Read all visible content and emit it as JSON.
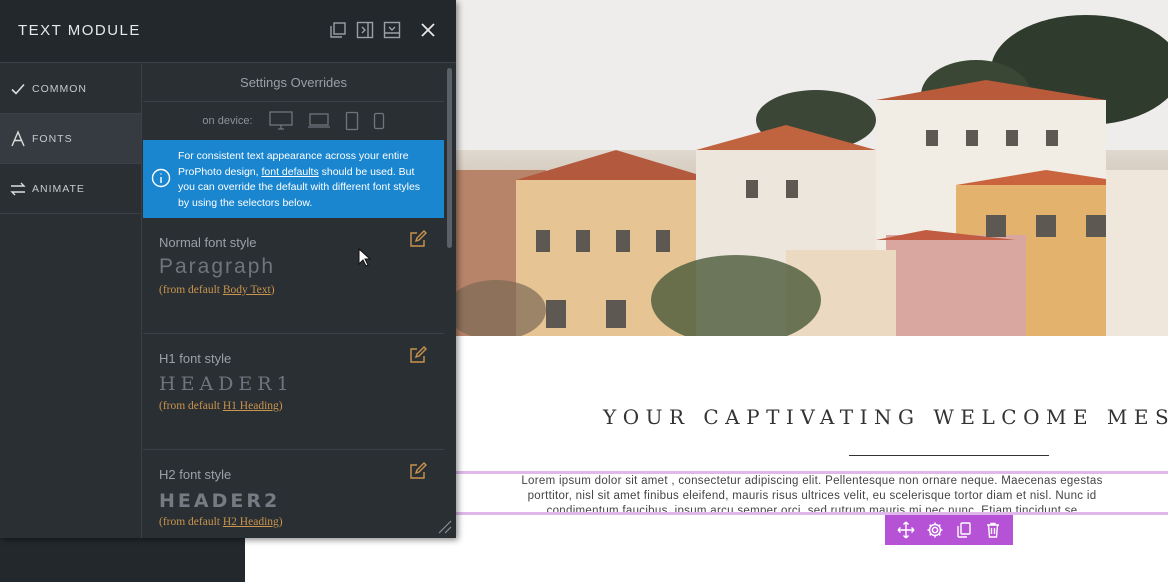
{
  "panel": {
    "title": "TEXT MODULE",
    "header_icons": [
      "duplicate-icon",
      "dock-right-icon",
      "minimize-icon",
      "close-icon"
    ]
  },
  "nav": {
    "items": [
      {
        "label": "COMMON",
        "icon": "checkmark-icon"
      },
      {
        "label": "FONTS",
        "icon": "letter-a-icon",
        "active": true
      },
      {
        "label": "ANIMATE",
        "icon": "swap-arrows-icon"
      }
    ]
  },
  "settings": {
    "heading": "Settings Overrides",
    "device_label": "on device:",
    "devices": [
      "desktop-icon",
      "laptop-icon",
      "tablet-icon",
      "phone-icon"
    ]
  },
  "info": {
    "text_1": "For consistent text appearance across your entire ProPhoto design,",
    "link": "font defaults",
    "text_2": "should be used. But you can override the default with different font styles by using the selectors below."
  },
  "fonts": [
    {
      "label": "Normal font style",
      "sample": "Paragraph",
      "from_prefix": "(from default",
      "from_link": "Body Text",
      "from_suffix": ")"
    },
    {
      "label": "H1 font style",
      "sample": "HEADER1",
      "from_prefix": "(from default",
      "from_link": "H1 Heading",
      "from_suffix": ")"
    },
    {
      "label": "H2 font style",
      "sample": "HEADER2",
      "from_prefix": "(from default",
      "from_link": "H2 Heading",
      "from_suffix": ")"
    }
  ],
  "preview": {
    "welcome": "YOUR CAPTIVATING WELCOME MESSAG",
    "lorem_lines": [
      "Lorem ipsum dolor sit amet , consectetur adipiscing elit. Pellentesque non ornare neque. Maecenas egestas",
      "porttitor, nisl sit amet finibus eleifend, mauris risus ultrices velit, eu scelerisque tortor diam et nisl. Nunc id",
      "condimentum faucibus, ipsum arcu semper orci, sed rutrum mauris mi nec nunc. Etiam tincidunt se"
    ],
    "toolbar": [
      "move-icon",
      "settings-gear-icon",
      "copy-icon",
      "trash-icon"
    ],
    "accent_color": "#b552d6"
  },
  "colors": {
    "info_bg": "#1a86d0",
    "link_orange": "#c9944d",
    "panel_bg": "#2a2f34"
  }
}
